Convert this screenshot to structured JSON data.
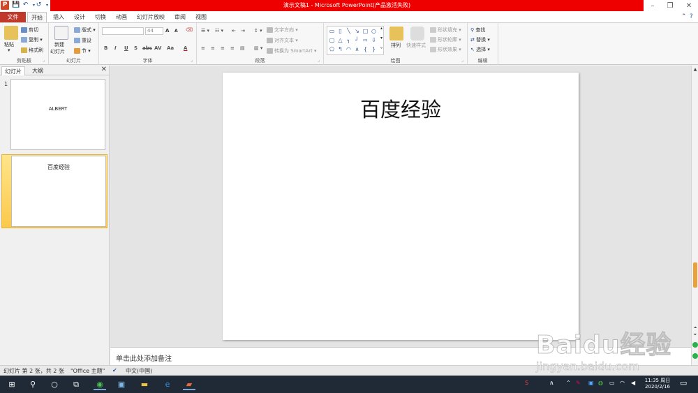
{
  "titlebar": {
    "app_icon": "P",
    "title": "演示文稿1 - Microsoft PowerPoint(产品激活失败)",
    "qa_save": "💾",
    "qa_undo": "↶",
    "qa_redo": "↺",
    "qa_more": "▾",
    "minimize": "–",
    "restore": "❐",
    "close": "✕"
  },
  "tabs": [
    {
      "label": "文件"
    },
    {
      "label": "开始"
    },
    {
      "label": "插入"
    },
    {
      "label": "设计"
    },
    {
      "label": "切换"
    },
    {
      "label": "动画"
    },
    {
      "label": "幻灯片放映"
    },
    {
      "label": "审阅"
    },
    {
      "label": "视图"
    }
  ],
  "ribbon": {
    "clipboard": {
      "label": "剪贴板",
      "paste": "粘贴",
      "cut": "剪切",
      "copy": "复制",
      "format_painter": "格式刷"
    },
    "slides": {
      "label": "幻灯片",
      "new_slide_1": "新建",
      "new_slide_2": "幻灯片",
      "layout": "版式",
      "reset": "重设",
      "section": "节"
    },
    "font": {
      "label": "字体",
      "font_name": "",
      "font_size": "44",
      "bold": "B",
      "italic": "I",
      "underline": "U",
      "shadow": "S",
      "strike": "abc",
      "spacing": "AV",
      "case": "Aa",
      "color": "A",
      "grow": "A",
      "shrink": "A"
    },
    "paragraph": {
      "label": "段落",
      "text_direction": "文字方向",
      "align_text": "对齐文本",
      "smartart": "转换为 SmartArt"
    },
    "drawing": {
      "label": "绘图",
      "arrange": "排列",
      "quick_styles": "快速样式",
      "shape_fill": "形状填充",
      "shape_outline": "形状轮廓",
      "shape_effects": "形状效果"
    },
    "editing": {
      "label": "编辑",
      "find": "查找",
      "replace": "替换",
      "select": "选择"
    }
  },
  "left_panel": {
    "tab_slides": "幻灯片",
    "tab_outline": "大纲",
    "close": "✕",
    "slides": [
      {
        "num": "1",
        "text": "ALBERT"
      },
      {
        "num": "2",
        "text": "百度经验"
      }
    ]
  },
  "slide": {
    "title": "百度经验"
  },
  "notes": {
    "placeholder": "单击此处添加备注"
  },
  "status": {
    "slide_info": "幻灯片 第 2 张，共 2 张",
    "theme": "\"Office 主题\"",
    "language": "中文(中国)"
  },
  "taskbar": {
    "clock_time": "11:35 周日",
    "clock_date": "2020/2/16"
  },
  "watermark": {
    "brand": "Baidu经验",
    "url": "jingyan.baidu.com"
  },
  "colors": {
    "file_tab": "#c0392b",
    "title_bar": "#ee0000",
    "selected_thumb": "#fbc94c",
    "taskbar": "#1f2a36"
  }
}
